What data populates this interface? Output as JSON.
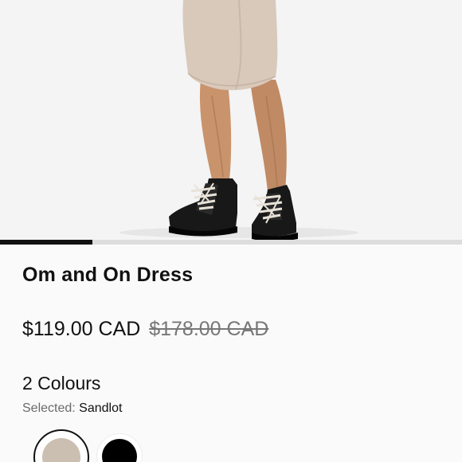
{
  "product": {
    "name": "Om and On Dress",
    "sale_price": "$119.00 CAD",
    "original_price": "$178.00 CAD",
    "colour_count_label": "2 Colours",
    "selected_label": "Selected:",
    "selected_value": "Sandlot"
  },
  "carousel": {
    "progress": 0.2
  },
  "swatches": [
    {
      "name": "Sandlot",
      "color": "#cbbfb2",
      "selected": true
    },
    {
      "name": "Black",
      "color": "#000000",
      "selected": false
    }
  ],
  "colors": {
    "text": "#111111",
    "muted": "#6b6b6b",
    "strike": "#777777",
    "background": "#fafafa"
  }
}
